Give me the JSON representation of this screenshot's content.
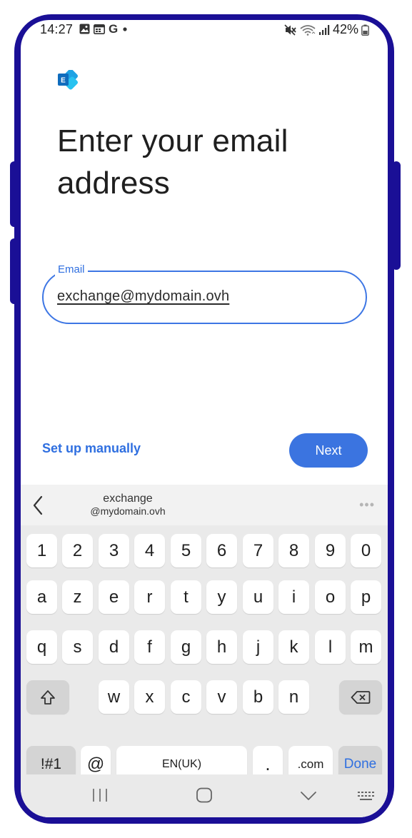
{
  "status_bar": {
    "time": "14:27",
    "left_icons": [
      "photo-icon",
      "calendar-icon",
      "google-icon",
      "dot-icon"
    ],
    "right_icons": [
      "mute-icon",
      "wifi-icon",
      "signal-icon",
      "battery-icon"
    ],
    "battery": "42%"
  },
  "app": {
    "logo": "exchange-logo",
    "title": "Enter your email address",
    "email_field": {
      "label": "Email",
      "value": "exchange@mydomain.ovh"
    },
    "setup_manually_label": "Set up manually",
    "next_label": "Next"
  },
  "keyboard": {
    "suggestion": {
      "line1": "exchange",
      "line2": "@mydomain.ovh"
    },
    "row_numbers": [
      "1",
      "2",
      "3",
      "4",
      "5",
      "6",
      "7",
      "8",
      "9",
      "0"
    ],
    "row_1": [
      "a",
      "z",
      "e",
      "r",
      "t",
      "y",
      "u",
      "i",
      "o",
      "p"
    ],
    "row_2": [
      "q",
      "s",
      "d",
      "f",
      "g",
      "h",
      "j",
      "k",
      "l",
      "m"
    ],
    "row_3": [
      "w",
      "x",
      "c",
      "v",
      "b",
      "n"
    ],
    "bottom_row": {
      "symbols": "!#1",
      "at": "@",
      "space": "EN(UK)",
      "period": ".",
      "dotcom": ".com",
      "done": "Done"
    }
  },
  "nav_bar": {
    "icons": [
      "recents-icon",
      "home-icon",
      "back-icon",
      "keyboard-icon"
    ]
  },
  "colors": {
    "frame": "#1a0f96",
    "accent": "#3b74e0",
    "keyboard_bg": "#eaeaea"
  }
}
